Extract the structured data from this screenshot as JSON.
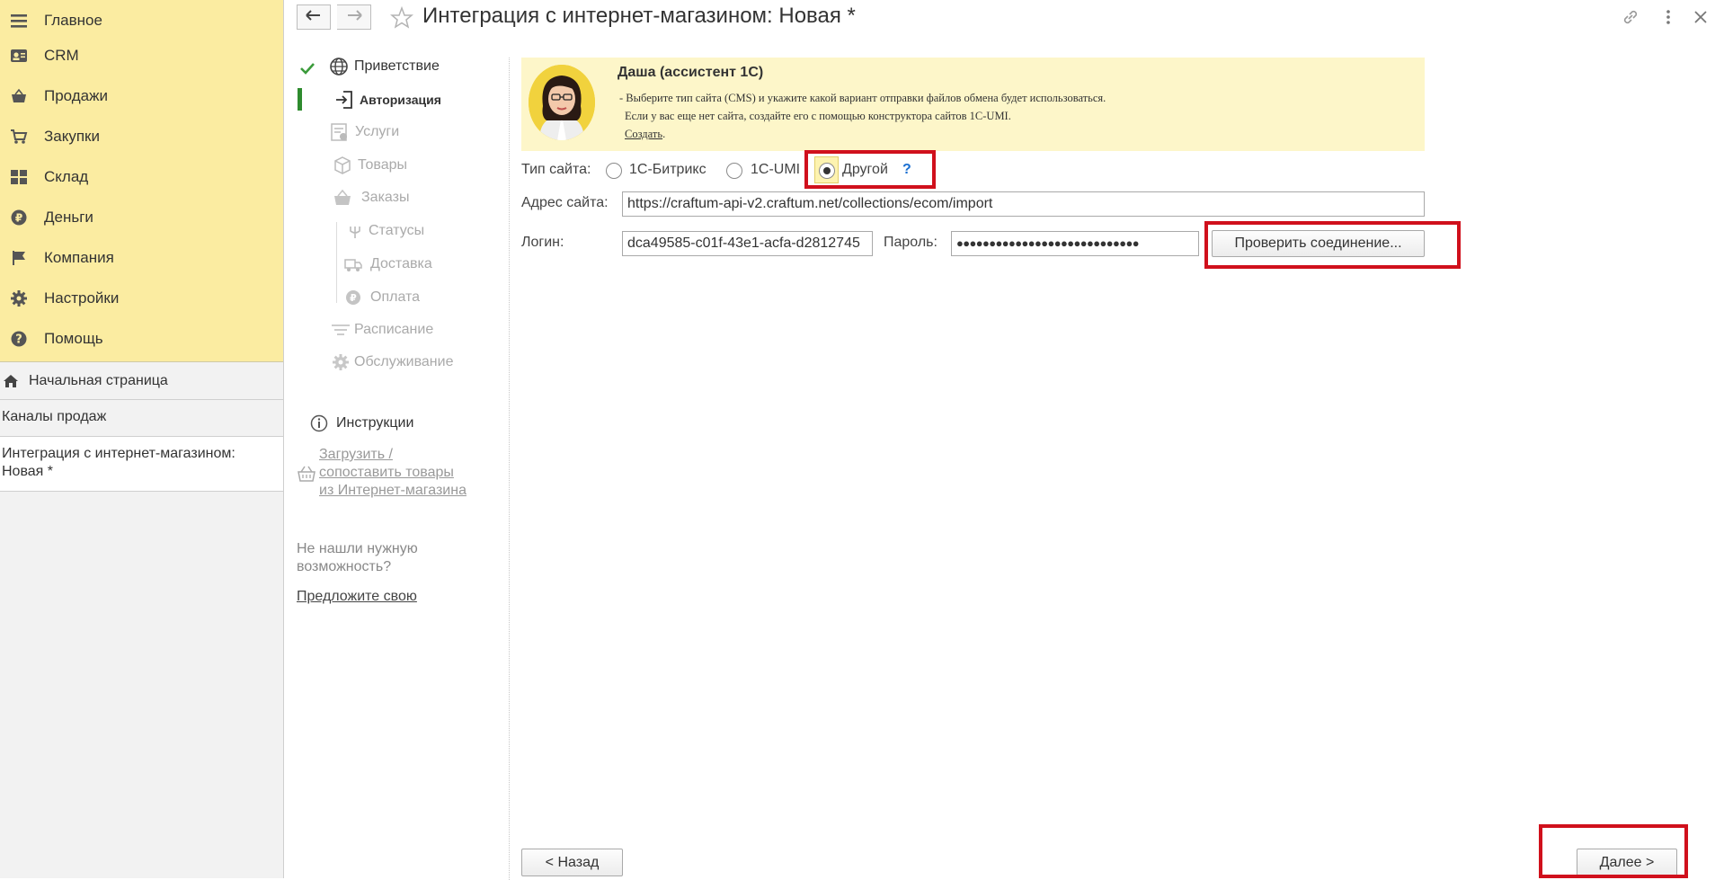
{
  "sidebar": {
    "menu": [
      {
        "label": "Главное",
        "icon": "hamburger-icon"
      },
      {
        "label": "CRM",
        "icon": "contacts-icon"
      },
      {
        "label": "Продажи",
        "icon": "basket-icon"
      },
      {
        "label": "Закупки",
        "icon": "cart-icon"
      },
      {
        "label": "Склад",
        "icon": "warehouse-grid-icon"
      },
      {
        "label": "Деньги",
        "icon": "ruble-coin-icon"
      },
      {
        "label": "Компания",
        "icon": "flag-icon"
      },
      {
        "label": "Настройки",
        "icon": "gear-icon"
      },
      {
        "label": "Помощь",
        "icon": "question-circle-icon"
      }
    ],
    "home_label": "Начальная страница",
    "open_windows": [
      "Каналы продаж",
      "Интеграция с интернет-магазином: Новая *"
    ]
  },
  "header": {
    "title": "Интеграция с интернет-магазином: Новая *"
  },
  "steps": {
    "items": [
      {
        "label": "Приветствие",
        "state": "done",
        "icon": "globe-icon"
      },
      {
        "label": "Авторизация",
        "state": "current",
        "icon": "login-icon"
      },
      {
        "label": "Услуги",
        "state": "disabled",
        "icon": "services-icon"
      },
      {
        "label": "Товары",
        "state": "disabled",
        "icon": "box-icon"
      },
      {
        "label": "Заказы",
        "state": "disabled",
        "icon": "basket-icon"
      },
      {
        "label": "Статусы",
        "state": "disabled",
        "icon": "trident-icon"
      },
      {
        "label": "Доставка",
        "state": "disabled",
        "icon": "delivery-icon"
      },
      {
        "label": "Оплата",
        "state": "disabled",
        "icon": "ruble-icon"
      },
      {
        "label": "Расписание",
        "state": "disabled",
        "icon": "schedule-icon"
      },
      {
        "label": "Обслуживание",
        "state": "disabled",
        "icon": "gear-icon"
      }
    ],
    "instructions_label": "Инструкции",
    "load_link": [
      "Загрузить /",
      "сопоставить товары",
      "из Интернет-магазина"
    ],
    "not_found": [
      "Не нашли нужную",
      "возможность?"
    ],
    "suggest_link": "Предложите свою"
  },
  "assistant": {
    "name": "Даша (ассистент 1С)",
    "line1": "- Выберите тип сайта (CMS) и укажите какой вариант отправки файлов обмена будет использоваться.",
    "line2": "Если у вас еще нет сайта, создайте его с помощью конструктора сайтов 1С-UMI.",
    "create_link": "Создать",
    "create_suffix": "."
  },
  "form": {
    "site_type_label": "Тип сайта:",
    "options": [
      {
        "label": "1С-Битрикс",
        "selected": false
      },
      {
        "label": "1С-UMI",
        "selected": false
      },
      {
        "label": "Другой",
        "selected": true
      }
    ],
    "help_mark": "?",
    "address_label": "Адрес сайта:",
    "address_value": "https://craftum-api-v2.craftum.net/collections/ecom/import",
    "login_label": "Логин:",
    "login_value": "dca49585-c01f-43e1-acfa-d2812745",
    "password_label": "Пароль:",
    "password_value": "●●●●●●●●●●●●●●●●●●●●●●●●●●●●",
    "check_button": "Проверить соединение..."
  },
  "footer": {
    "back_button": "< Назад",
    "next_button": "Далее >"
  },
  "colors": {
    "menu_bg": "#fbeca1",
    "assistant_bg": "#fdf6c9",
    "highlight": "#d0101c",
    "done_check": "#3b9b3b",
    "current_marker": "#2e8b2e",
    "help": "#1a6fd1"
  }
}
